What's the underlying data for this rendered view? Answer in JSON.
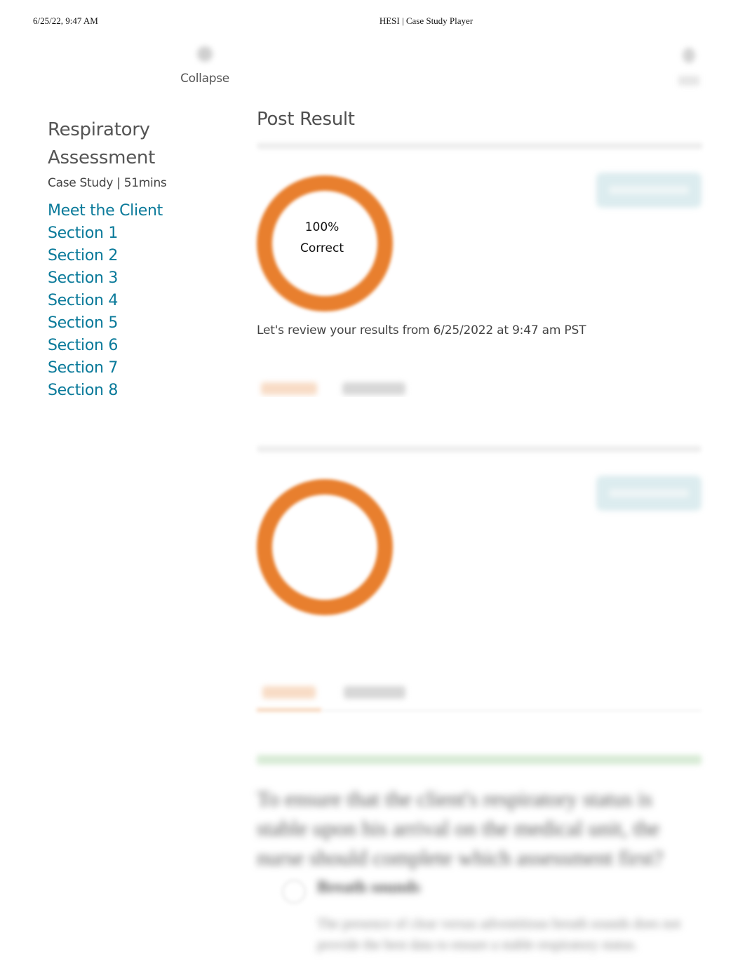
{
  "print_header": {
    "datetime": "6/25/22, 9:47 AM",
    "page_title": "HESI | Case Study Player"
  },
  "toolbar": {
    "collapse_label": "Collapse",
    "collapse_icon": "collapse-icon",
    "right_icon": "menu-icon"
  },
  "sidebar": {
    "case_title": "Respiratory Assessment",
    "case_meta": "Case Study | 51mins",
    "items": [
      {
        "label": "Meet the Client"
      },
      {
        "label": "Section 1"
      },
      {
        "label": "Section 2"
      },
      {
        "label": "Section 3"
      },
      {
        "label": "Section 4"
      },
      {
        "label": "Section 5"
      },
      {
        "label": "Section 6"
      },
      {
        "label": "Section 7"
      },
      {
        "label": "Section 8"
      }
    ]
  },
  "main": {
    "title": "Post Result",
    "score": {
      "percent_correct": 100,
      "percent_label": "100%",
      "label": "Correct",
      "ring_color": "#e87f2e"
    },
    "review_text": "Let's review your results from 6/25/2022 at 9:47 am PST",
    "tabs": [
      {
        "label": "Correct",
        "active": true
      },
      {
        "label": "Incorrect",
        "active": false
      }
    ],
    "question": {
      "text": "To ensure that the client's respiratory status is stable upon his arrival on the medical unit, the nurse should complete which assessment first?",
      "options": [
        {
          "label": "Breath sounds",
          "rationale": "The presence of clear versus adventitious breath sounds does not provide the best data to ensure a stable respiratory status."
        }
      ]
    }
  },
  "colors": {
    "accent_link": "#0a7a9a",
    "score_ring": "#e87f2e",
    "correct_bar": "#d8ebd6"
  }
}
